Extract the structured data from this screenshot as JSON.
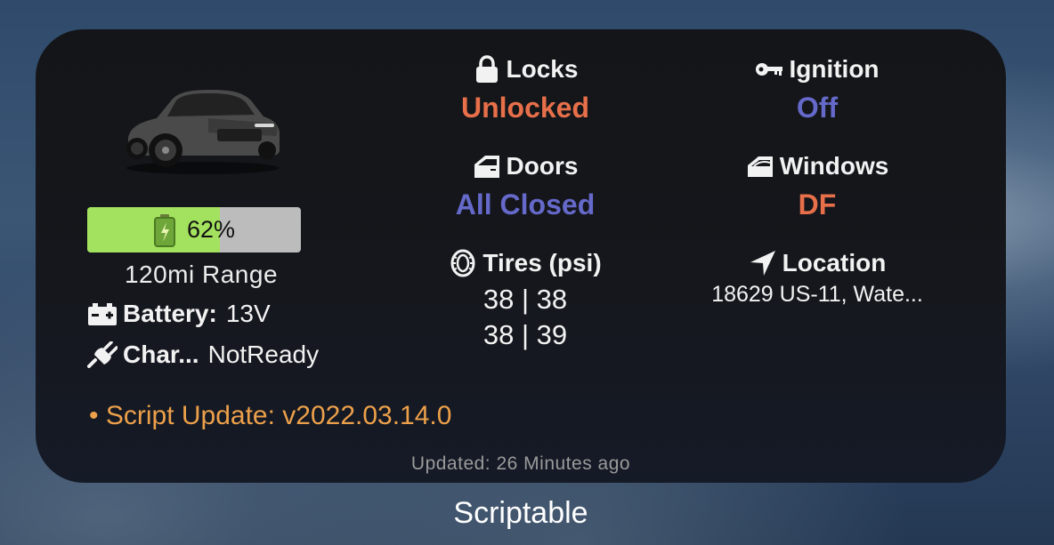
{
  "widget": {
    "battery": {
      "percent_label": "62%",
      "percent": 62,
      "fill_color": "#a3e25e",
      "icon": "battery-icon"
    },
    "range": "120mi Range",
    "battery_voltage": {
      "label": "Battery:",
      "value": "13V",
      "icon": "car-battery-icon"
    },
    "charging": {
      "label": "Char...",
      "value": "NotReady",
      "icon": "plug-icon"
    },
    "locks": {
      "label": "Locks",
      "value": "Unlocked",
      "icon": "lock-icon",
      "color": "#e76f4a"
    },
    "ignition": {
      "label": "Ignition",
      "value": "Off",
      "icon": "key-icon",
      "color": "#6569c9"
    },
    "doors": {
      "label": "Doors",
      "value": "All Closed",
      "icon": "door-icon",
      "color": "#6569c9"
    },
    "windows": {
      "label": "Windows",
      "value": "DF",
      "icon": "window-icon",
      "color": "#e76f4a"
    },
    "tires": {
      "label": "Tires (psi)",
      "front": "38 | 38",
      "rear": "38 | 39",
      "icon": "tire-icon"
    },
    "location": {
      "label": "Location",
      "value": "18629 US-11, Wate...",
      "icon": "location-arrow-icon"
    },
    "script_update": "• Script Update: v2022.03.14.0",
    "updated": "Updated: 26 Minutes ago"
  },
  "app_name": "Scriptable"
}
